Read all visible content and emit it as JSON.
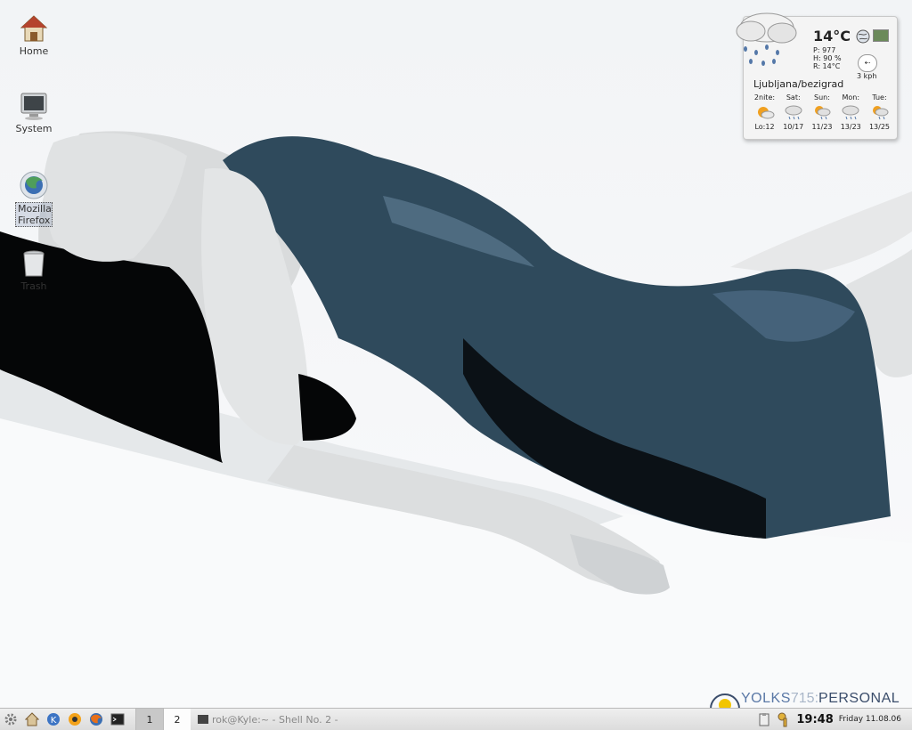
{
  "desktop": {
    "icons": [
      {
        "label": "Home",
        "icon": "home-icon"
      },
      {
        "label": "System",
        "icon": "computer-icon"
      },
      {
        "label": "Mozilla Firefox",
        "icon": "firefox-icon"
      },
      {
        "label": "Trash",
        "icon": "trash-icon"
      }
    ]
  },
  "weather": {
    "temperature": "14°C",
    "pressure": "P: 977",
    "humidity": "H: 90 %",
    "realfeel": "R: 14°C",
    "wind": "3 kph",
    "location": "Ljubljana/bezigrad",
    "forecast": [
      {
        "day": "2nite:",
        "temps": "Lo:12",
        "icon": "partly-sunny-icon"
      },
      {
        "day": "Sat:",
        "temps": "10/17",
        "icon": "rain-cloud-icon"
      },
      {
        "day": "Sun:",
        "temps": "11/23",
        "icon": "sun-rain-icon"
      },
      {
        "day": "Mon:",
        "temps": "13/23",
        "icon": "rain-cloud-icon"
      },
      {
        "day": "Tue:",
        "temps": "13/25",
        "icon": "sun-rain-icon"
      }
    ]
  },
  "branding": {
    "part1": "YOLKS",
    "part2": "715",
    "part3": "PERSONAL"
  },
  "taskbar": {
    "launchers": [
      "kde-menu-icon",
      "home-icon",
      "konqueror-icon",
      "browser-icon",
      "firefox-icon",
      "terminal-icon"
    ],
    "pages": [
      "1",
      "2"
    ],
    "task": "rok@Kyle:~ - Shell No. 2 -",
    "time": "19:48",
    "date": "Friday 11.08.06"
  },
  "colors": {
    "dress": "#2f4a5c",
    "hair": "#050607",
    "skin": "#dcdedf"
  }
}
